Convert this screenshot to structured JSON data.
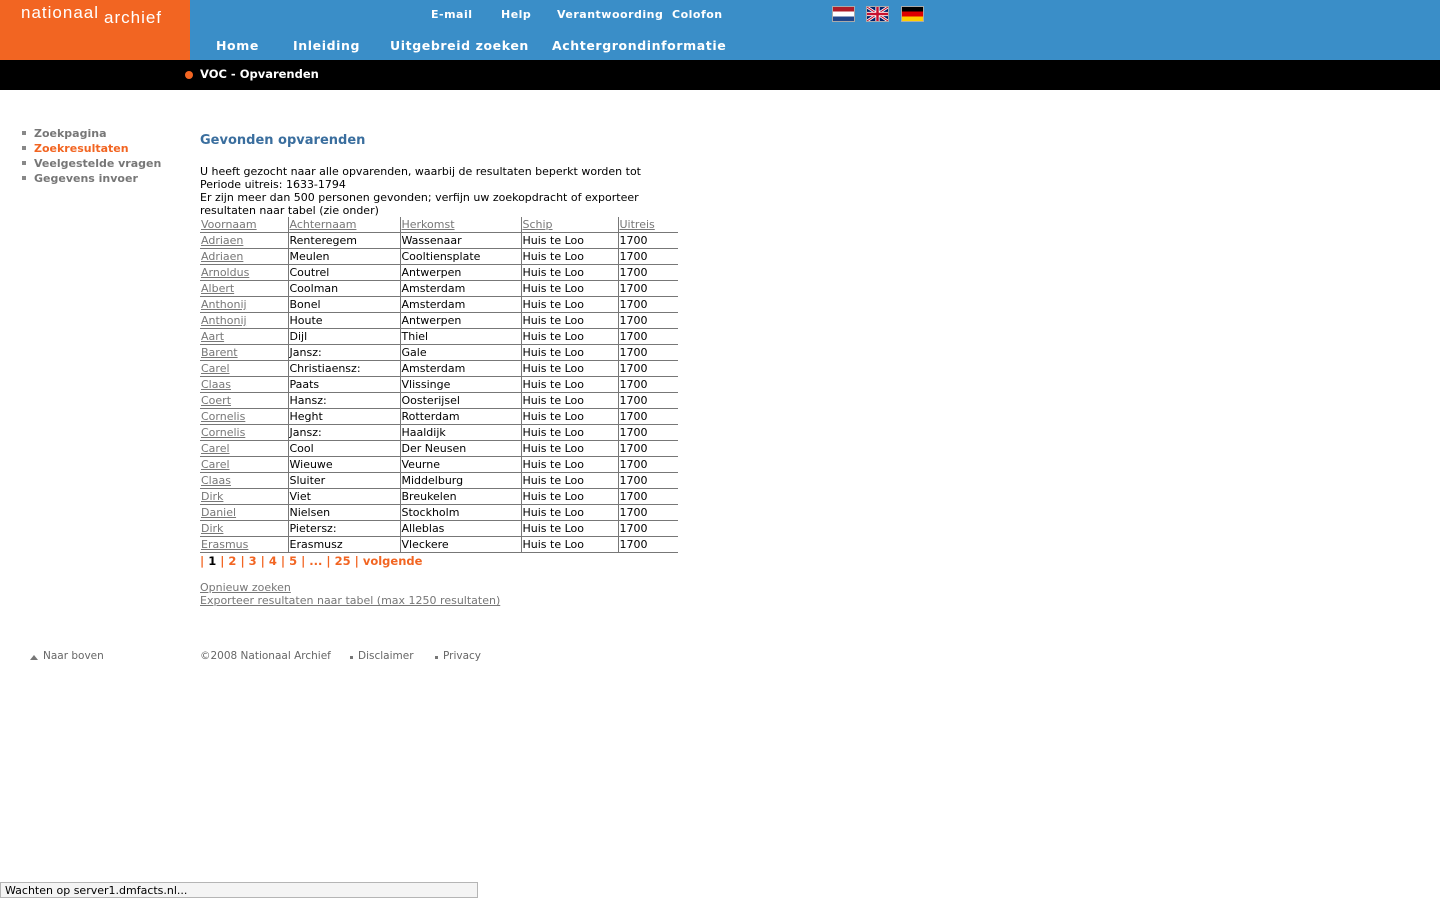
{
  "logo": {
    "word1": "nationaal",
    "word2": "archief"
  },
  "utility_nav": [
    "E-mail",
    "Help",
    "Verantwoording",
    "Colofon"
  ],
  "languages": [
    "nl-flag-icon",
    "gb-flag-icon",
    "de-flag-icon"
  ],
  "main_nav": [
    "Home",
    "Inleiding",
    "Uitgebreid zoeken",
    "Achtergrondinformatie"
  ],
  "section_title": "VOC - Opvarenden",
  "sidebar": [
    {
      "label": "Zoekpagina",
      "active": false
    },
    {
      "label": "Zoekresultaten",
      "active": true
    },
    {
      "label": "Veelgestelde vragen",
      "active": false
    },
    {
      "label": "Gegevens invoer",
      "active": false
    }
  ],
  "heading": "Gevonden opvarenden",
  "intro": [
    "U heeft gezocht naar alle opvarenden, waarbij de resultaten beperkt worden tot",
    "Periode uitreis: 1633-1794",
    "Er zijn meer dan 500 personen gevonden; verfijn uw zoekopdracht of exporteer",
    "resultaten naar tabel (zie onder)"
  ],
  "table": {
    "headers": [
      "Voornaam",
      "Achternaam",
      "Herkomst",
      "Schip",
      "Uitreis"
    ],
    "rows": [
      [
        "Adriaen",
        "Renteregem",
        "Wassenaar",
        "Huis te Loo",
        "1700"
      ],
      [
        "Adriaen",
        "Meulen",
        "Cooltiensplate",
        "Huis te Loo",
        "1700"
      ],
      [
        "Arnoldus",
        "Coutrel",
        "Antwerpen",
        "Huis te Loo",
        "1700"
      ],
      [
        "Albert",
        "Coolman",
        "Amsterdam",
        "Huis te Loo",
        "1700"
      ],
      [
        "Anthonij",
        "Bonel",
        "Amsterdam",
        "Huis te Loo",
        "1700"
      ],
      [
        "Anthonij",
        "Houte",
        "Antwerpen",
        "Huis te Loo",
        "1700"
      ],
      [
        "Aart",
        "Dijl",
        "Thiel",
        "Huis te Loo",
        "1700"
      ],
      [
        "Barent",
        "Jansz:",
        "Gale",
        "Huis te Loo",
        "1700"
      ],
      [
        "Carel",
        "Christiaensz:",
        "Amsterdam",
        "Huis te Loo",
        "1700"
      ],
      [
        "Claas",
        "Paats",
        "Vlissinge",
        "Huis te Loo",
        "1700"
      ],
      [
        "Coert",
        "Hansz:",
        "Oosterijsel",
        "Huis te Loo",
        "1700"
      ],
      [
        "Cornelis",
        "Heght",
        "Rotterdam",
        "Huis te Loo",
        "1700"
      ],
      [
        "Cornelis",
        "Jansz:",
        "Haaldijk",
        "Huis te Loo",
        "1700"
      ],
      [
        "Carel",
        "Cool",
        "Der Neusen",
        "Huis te Loo",
        "1700"
      ],
      [
        "Carel",
        "Wieuwe",
        "Veurne",
        "Huis te Loo",
        "1700"
      ],
      [
        "Claas",
        "Sluiter",
        "Middelburg",
        "Huis te Loo",
        "1700"
      ],
      [
        "Dirk",
        "Viet",
        "Breukelen",
        "Huis te Loo",
        "1700"
      ],
      [
        "Daniel",
        "Nielsen",
        "Stockholm",
        "Huis te Loo",
        "1700"
      ],
      [
        "Dirk",
        "Pietersz:",
        "Alleblas",
        "Huis te Loo",
        "1700"
      ],
      [
        "Erasmus",
        "Erasmusz",
        "Vleckere",
        "Huis te Loo",
        "1700"
      ]
    ]
  },
  "pager": {
    "items": [
      "|",
      "1",
      "|",
      "2",
      "|",
      "3",
      "|",
      "4",
      "|",
      "5",
      "|",
      "...",
      "|",
      "25",
      "|",
      "volgende"
    ],
    "current": "1"
  },
  "links": {
    "opnieuw": "Opnieuw zoeken",
    "export": "Exporteer resultaten naar tabel (max 1250 resultaten)"
  },
  "footer": {
    "top": "Naar boven",
    "copyright": "©2008 Nationaal Archief",
    "disclaimer": "Disclaimer",
    "privacy": "Privacy"
  },
  "status_bar": "Wachten op server1.dmfacts.nl...",
  "colors": {
    "orange": "#f26522",
    "blue": "#3a8ec8",
    "heading_blue": "#3a6e9e"
  }
}
